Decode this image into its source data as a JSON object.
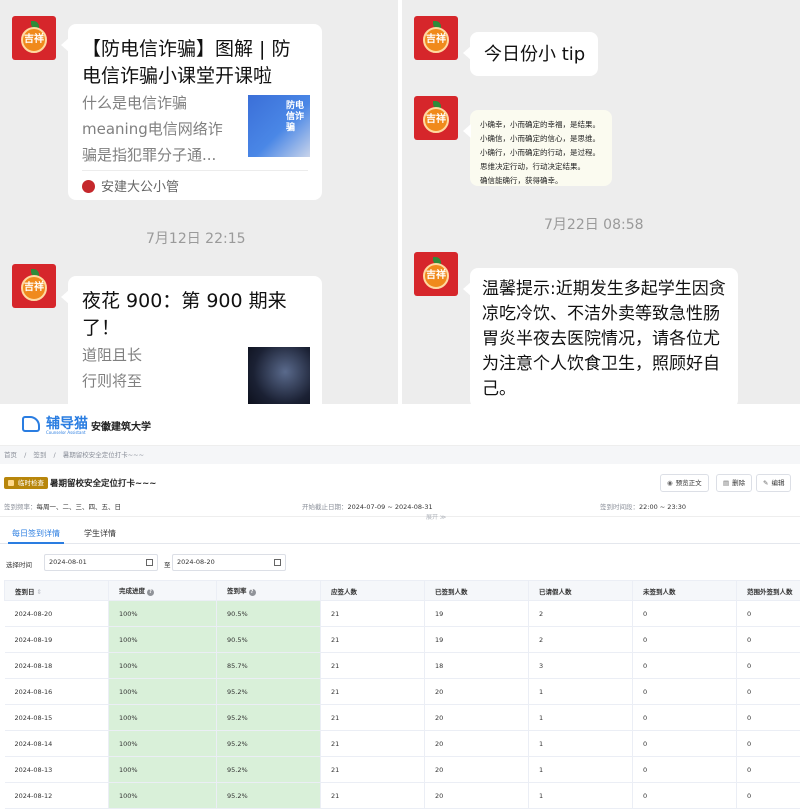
{
  "chat": {
    "left": {
      "article1": {
        "title": "【防电信诈骗】图解 | 防电信诈骗小课堂开课啦",
        "desc": "什么是电信诈骗meaning电信网络诈骗是指犯罪分子通...",
        "thumb_text": "防电信诈骗",
        "source": "安建大公小管"
      },
      "timestamp1": "7月12日 22:15",
      "article2": {
        "title": "夜花 900：第 900 期来了！",
        "desc_line1": "道阻且长",
        "desc_line2": "行则将至"
      }
    },
    "right": {
      "msg1": "今日份小 tip",
      "tip_lines": [
        "小确幸，小而确定的幸福，是结果。",
        "小确信，小而确定的信心，是思维。",
        "小确行，小而确定的行动，是过程。",
        "思维决定行动，行动决定结果。",
        "确信能确行，获得确幸。"
      ],
      "timestamp": "7月22日 08:58",
      "warm_tip": "温馨提示:近期发生多起学生因贪凉吃冷饮、不洁外卖等致急性肠胃炎半夜去医院情况，请各位尤为注意个人饮食卫生，照顾好自己。"
    },
    "avatar_glyph": "吉祥"
  },
  "app": {
    "logo": "辅导猫",
    "logo_sub": "Counselor Assistant",
    "school": "安徽建筑大学",
    "breadcrumbs": [
      "首页",
      "/",
      "签到",
      "/",
      "暑期留校安全定位打卡~~~"
    ],
    "tag": "临时检查",
    "page_title": "暑期留校安全定位打卡~~~",
    "buttons": {
      "preview": "预览正文",
      "delete": "删除",
      "edit": "编辑"
    },
    "meta": {
      "freq_label": "签到频率：",
      "freq_value": "每周一、二、三、四、五、日",
      "date_label": "开始截止日期：",
      "date_value": "2024-07-09 ~ 2024-08-31",
      "time_label": "签到时间段：",
      "time_value": "22:00 ~ 23:30"
    },
    "expand": "展开 ≫",
    "tabs": {
      "daily": "每日签到详情",
      "students": "学生详情"
    },
    "filter": {
      "label": "选择时间",
      "start": "2024-08-01",
      "sep": "至",
      "end": "2024-08-20"
    },
    "table": {
      "headers": [
        "签到日",
        "完成进度",
        "签到率",
        "应签人数",
        "已签到人数",
        "已请假人数",
        "未签到人数",
        "范围外签到人数"
      ],
      "rows": [
        [
          "2024-08-20",
          "100%",
          "90.5%",
          "21",
          "19",
          "2",
          "0",
          "0"
        ],
        [
          "2024-08-19",
          "100%",
          "90.5%",
          "21",
          "19",
          "2",
          "0",
          "0"
        ],
        [
          "2024-08-18",
          "100%",
          "85.7%",
          "21",
          "18",
          "3",
          "0",
          "0"
        ],
        [
          "2024-08-16",
          "100%",
          "95.2%",
          "21",
          "20",
          "1",
          "0",
          "0"
        ],
        [
          "2024-08-15",
          "100%",
          "95.2%",
          "21",
          "20",
          "1",
          "0",
          "0"
        ],
        [
          "2024-08-14",
          "100%",
          "95.2%",
          "21",
          "20",
          "1",
          "0",
          "0"
        ],
        [
          "2024-08-13",
          "100%",
          "95.2%",
          "21",
          "20",
          "1",
          "0",
          "0"
        ],
        [
          "2024-08-12",
          "100%",
          "95.2%",
          "21",
          "20",
          "1",
          "0",
          "0"
        ]
      ]
    }
  }
}
